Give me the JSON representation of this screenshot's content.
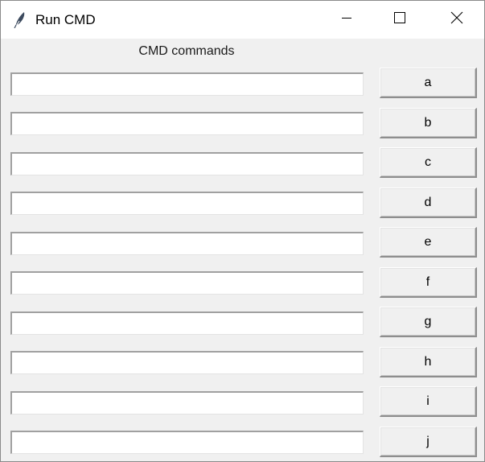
{
  "window": {
    "title": "Run CMD",
    "controls": {
      "minimize_icon": "minimize-icon",
      "maximize_icon": "maximize-icon",
      "close_icon": "close-icon"
    }
  },
  "main": {
    "header_label": "CMD commands",
    "entries": [
      {
        "value": "",
        "placeholder": ""
      },
      {
        "value": "",
        "placeholder": ""
      },
      {
        "value": "",
        "placeholder": ""
      },
      {
        "value": "",
        "placeholder": ""
      },
      {
        "value": "",
        "placeholder": ""
      },
      {
        "value": "",
        "placeholder": ""
      },
      {
        "value": "",
        "placeholder": ""
      },
      {
        "value": "",
        "placeholder": ""
      },
      {
        "value": "",
        "placeholder": ""
      },
      {
        "value": "",
        "placeholder": ""
      }
    ],
    "buttons": [
      {
        "label": "a"
      },
      {
        "label": "b"
      },
      {
        "label": "c"
      },
      {
        "label": "d"
      },
      {
        "label": "e"
      },
      {
        "label": "f"
      },
      {
        "label": "g"
      },
      {
        "label": "h"
      },
      {
        "label": "i"
      },
      {
        "label": "j"
      }
    ]
  },
  "colors": {
    "background": "#f0f0f0",
    "titlebar": "#ffffff",
    "entry_background": "#ffffff",
    "text": "#000000"
  }
}
